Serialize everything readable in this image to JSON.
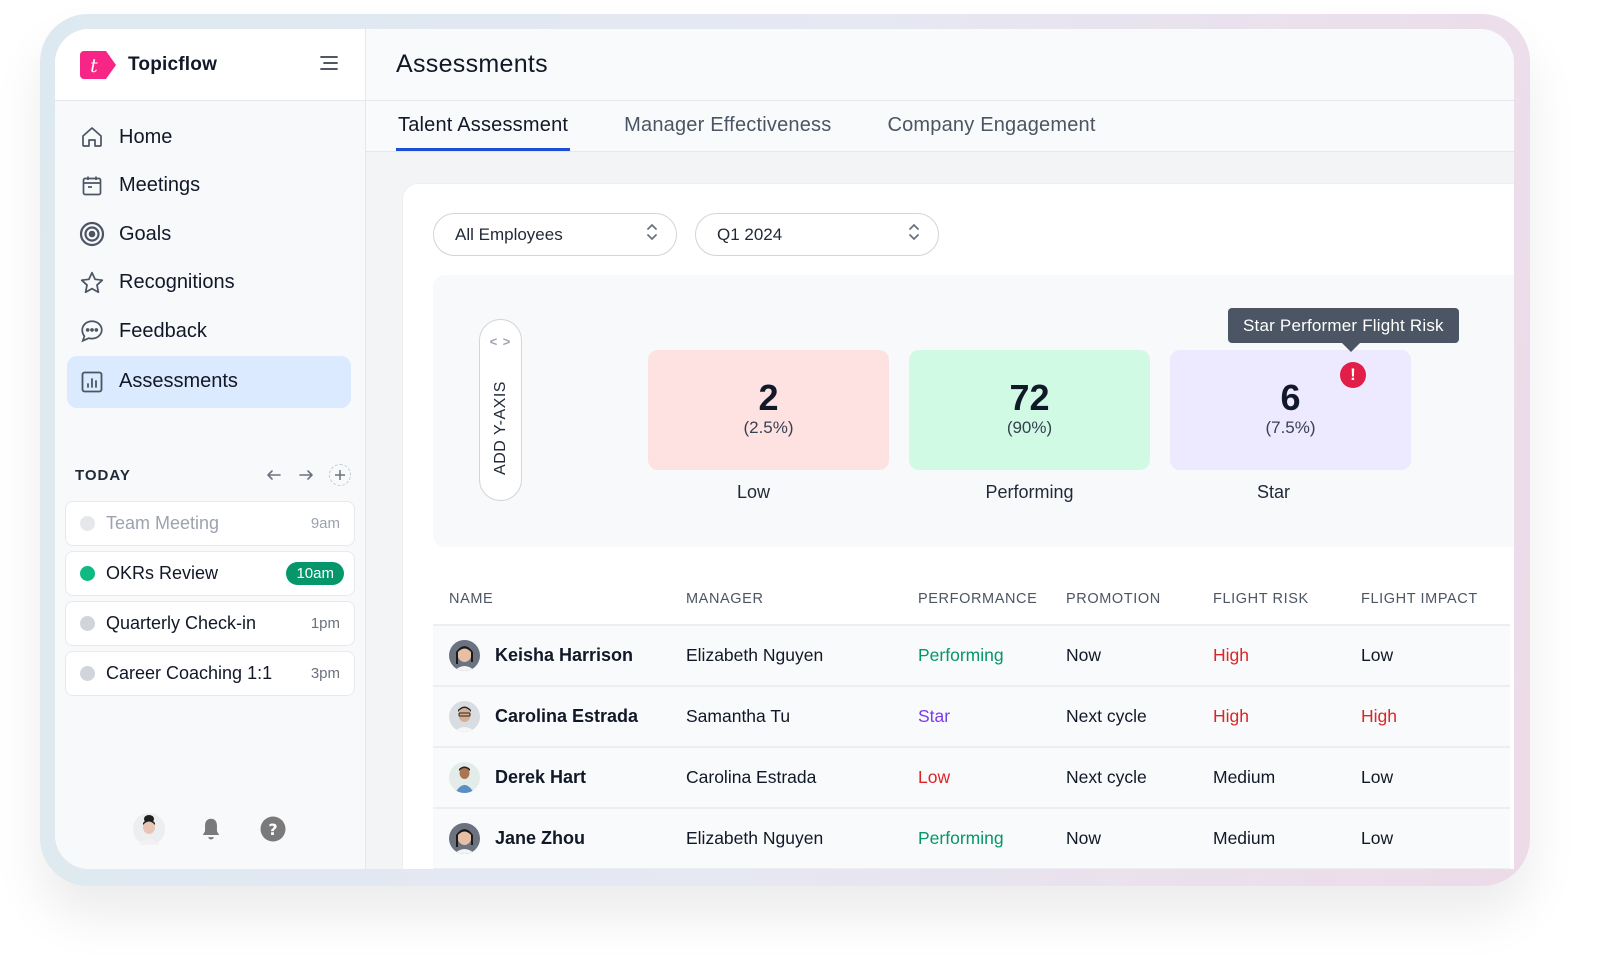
{
  "app": {
    "name": "Topicflow",
    "brand_color": "#f72585"
  },
  "sidebar": {
    "items": [
      {
        "label": "Home",
        "icon": "home-icon"
      },
      {
        "label": "Meetings",
        "icon": "calendar-icon"
      },
      {
        "label": "Goals",
        "icon": "target-icon"
      },
      {
        "label": "Recognitions",
        "icon": "star-icon"
      },
      {
        "label": "Feedback",
        "icon": "chat-bubble-icon"
      },
      {
        "label": "Assessments",
        "icon": "bar-chart-icon",
        "active": true
      }
    ],
    "today": {
      "title": "TODAY",
      "events": [
        {
          "name": "Team Meeting",
          "time": "9am",
          "state": "past"
        },
        {
          "name": "OKRs Review",
          "time": "10am",
          "state": "current"
        },
        {
          "name": "Quarterly Check-in",
          "time": "1pm",
          "state": "upcoming"
        },
        {
          "name": "Career Coaching 1:1",
          "time": "3pm",
          "state": "upcoming"
        }
      ]
    },
    "footer": [
      "user-avatar",
      "bell-icon",
      "help-icon"
    ]
  },
  "header": {
    "title": "Assessments"
  },
  "tabs": [
    {
      "label": "Talent Assessment",
      "active": true
    },
    {
      "label": "Manager Effectiveness",
      "active": false
    },
    {
      "label": "Company Engagement",
      "active": false
    }
  ],
  "filters": {
    "group": "All Employees",
    "period": "Q1 2024"
  },
  "grid": {
    "y_axis_button": "ADD Y-AXIS",
    "tooltip": "Star Performer Flight Risk",
    "boxes": [
      {
        "label": "Low",
        "count": "2",
        "percent": "(2.5%)",
        "color": "#fee2e2"
      },
      {
        "label": "Performing",
        "count": "72",
        "percent": "(90%)",
        "color": "#d1fae5"
      },
      {
        "label": "Star",
        "count": "6",
        "percent": "(7.5%)",
        "color": "#ede9fe",
        "alert": true
      }
    ]
  },
  "table": {
    "columns": [
      "NAME",
      "MANAGER",
      "PERFORMANCE",
      "PROMOTION",
      "FLIGHT RISK",
      "FLIGHT IMPACT"
    ],
    "rows": [
      {
        "name": "Keisha Harrison",
        "manager": "Elizabeth Nguyen",
        "performance": "Performing",
        "promotion": "Now",
        "flight_risk": "High",
        "flight_impact": "Low"
      },
      {
        "name": "Carolina Estrada",
        "manager": "Samantha Tu",
        "performance": "Star",
        "promotion": "Next cycle",
        "flight_risk": "High",
        "flight_impact": "High"
      },
      {
        "name": "Derek Hart",
        "manager": "Carolina Estrada",
        "performance": "Low",
        "promotion": "Next cycle",
        "flight_risk": "Medium",
        "flight_impact": "Low"
      },
      {
        "name": "Jane Zhou",
        "manager": "Elizabeth Nguyen",
        "performance": "Performing",
        "promotion": "Now",
        "flight_risk": "Medium",
        "flight_impact": "Low"
      }
    ]
  },
  "colors": {
    "performing": "#059669",
    "star": "#7c3aed",
    "low": "#dc2626",
    "high": "#dc2626",
    "neutral": "#111827",
    "tab_active_underline": "#1d4ed8"
  }
}
